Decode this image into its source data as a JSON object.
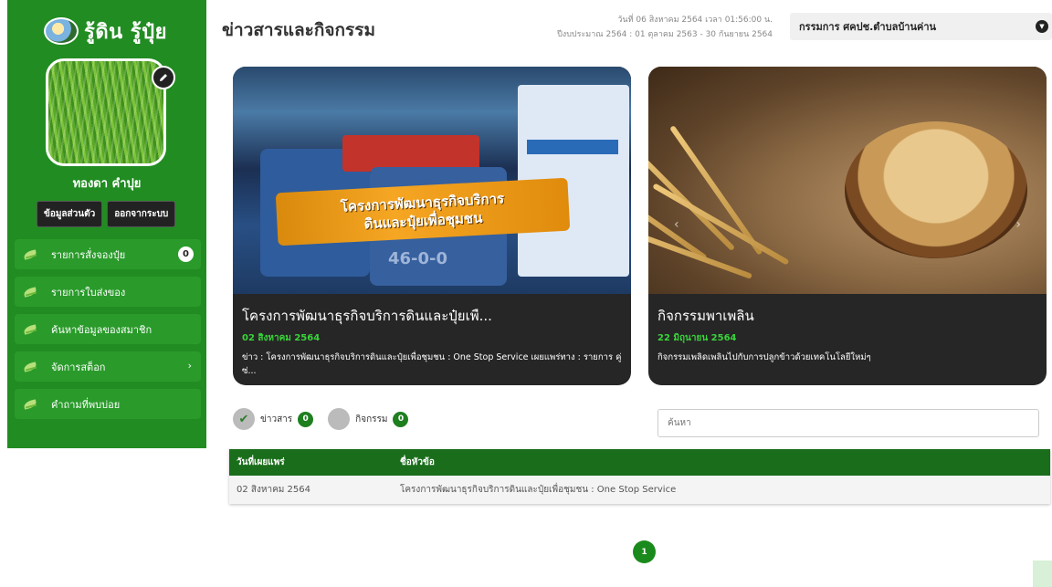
{
  "sidebar": {
    "brand": "รู้ดิน รู้ปุ๋ย",
    "username": "ทองดา คำปุย",
    "profile_button": "ข้อมูลส่วนตัว",
    "logout_button": "ออกจากระบบ",
    "menu": [
      {
        "label": "รายการสั่งจองปุ๋ย",
        "badge": "0"
      },
      {
        "label": "รายการใบส่งของ"
      },
      {
        "label": "ค้นหาข้อมูลของสมาชิก"
      },
      {
        "label": "จัดการสต็อก",
        "chevron": "›"
      },
      {
        "label": "คำถามที่พบบ่อย"
      }
    ]
  },
  "header": {
    "title": "ข่าวสารและกิจกรรม",
    "datetime": "วันที่ 06 สิงหาคม 2564 เวลา 01:56:00 น.",
    "fiscal_year": "ปีงบประมาณ 2564 : 01 ตุลาคม 2563 - 30 กันยายน 2564",
    "department": "กรรมการ ศคปช.ตำบลบ้านค่าน"
  },
  "cards": [
    {
      "banner_line1": "โครงการพัฒนาธุรกิจบริการ",
      "banner_line2": "ดินและปุ๋ยเพื่อชุมชน",
      "image_number": "46-0-0",
      "title": "โครงการพัฒนาธุรกิจบริการดินและปุ๋ยเพื...",
      "date": "02 สิงหาคม 2564",
      "description": "ข่าว : โครงการพัฒนาธุรกิจบริการดินและปุ๋ยเพื่อชุมชน : One Stop Service เผยแพร่ทาง : รายการ คู่ซ่..."
    },
    {
      "title": "กิจกรรมพาเพลิน",
      "date": "22 มิถุนายน 2564",
      "description": "กิจกรรมเพลิดเพลินไปกับการปลูกข้าวด้วยเทคโนโลยีใหม่ๆ"
    }
  ],
  "filters": {
    "news_label": "ข่าวสาร",
    "news_count": "0",
    "activity_label": "กิจกรรม",
    "activity_count": "0",
    "search_placeholder": "ค้นหา"
  },
  "table": {
    "headers": [
      "วันที่เผยแพร่",
      "ชื่อหัวข้อ"
    ],
    "rows": [
      [
        "02 สิงหาคม 2564",
        "โครงการพัฒนาธุรกิจบริการดินและปุ๋ยเพื่อชุมชน : One Stop Service"
      ]
    ]
  },
  "pagination": {
    "current": "1"
  },
  "icons": {
    "brand": "farm-logo-icon",
    "edit": "pencil-icon",
    "menu": "leaf-icon",
    "dropdown": "chevron-down-icon",
    "filter_selected": "check-icon"
  },
  "colors": {
    "primary": "#218c22",
    "dark_green": "#1a6e1b",
    "accent_green": "#39d43a",
    "card_bg": "#262626"
  }
}
